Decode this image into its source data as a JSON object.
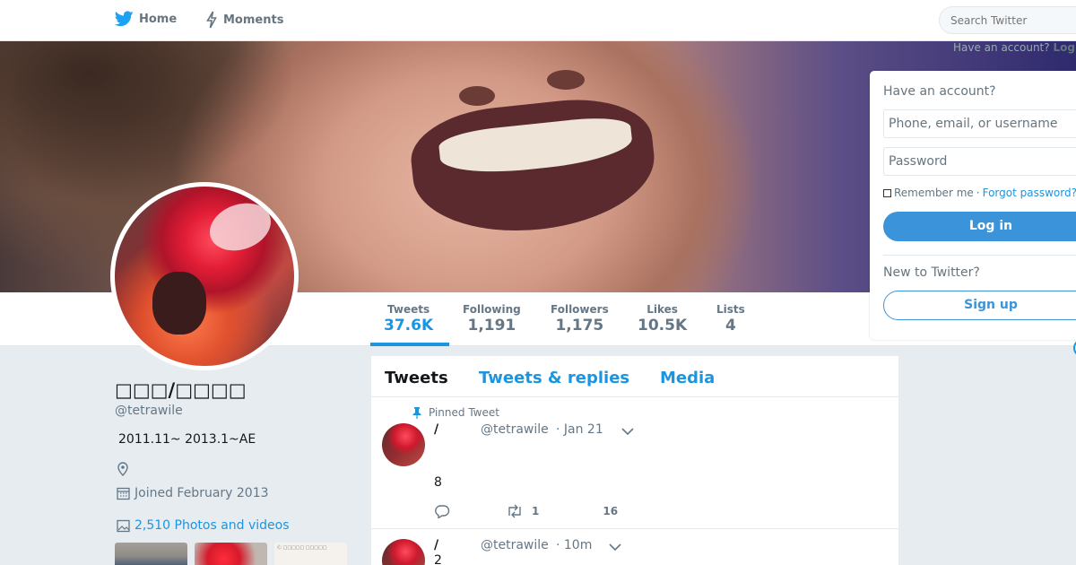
{
  "topbar": {
    "home_label": "Home",
    "moments_label": "Moments",
    "search_placeholder": "Search Twitter",
    "have_account": "Have an account?",
    "login_link": "Log"
  },
  "profile_nav": {
    "stats": [
      {
        "label": "Tweets",
        "value": "37.6K"
      },
      {
        "label": "Following",
        "value": "1,191"
      },
      {
        "label": "Followers",
        "value": "1,175"
      },
      {
        "label": "Likes",
        "value": "10.5K"
      },
      {
        "label": "Lists",
        "value": "4"
      }
    ]
  },
  "profile": {
    "name": "□□□/□□□□",
    "handle": "@tetrawile",
    "bio": "2011.11~ 2013.1~AE",
    "joined": "Joined February 2013",
    "photos": "2,510 Photos and videos"
  },
  "timeline": {
    "tabs": [
      "Tweets",
      "Tweets & replies",
      "Media"
    ],
    "tweets": [
      {
        "pinned_label": "Pinned Tweet",
        "name": "/",
        "handle": "@tetrawile",
        "time": "· Jan 21",
        "body": "8",
        "replies": "",
        "retweets": "1",
        "likes": "16"
      },
      {
        "name": "/",
        "handle": "@tetrawile",
        "time": "· 10m",
        "body": "2"
      }
    ]
  },
  "login_card": {
    "title": "Have an account?",
    "username_placeholder": "Phone, email, or username",
    "password_placeholder": "Password",
    "remember": "Remember me",
    "separator": "·",
    "forgot": "Forgot password?",
    "login_button": "Log in",
    "new_to_twitter": "New to Twitter?",
    "signup_button": "Sign up"
  },
  "thumb3_text": "Ⓒ\n□□□□□ □□□□□",
  "colors": {
    "accent": "#1b95e0",
    "button_blue": "#3b94d9",
    "background": "#e6ecf0"
  }
}
